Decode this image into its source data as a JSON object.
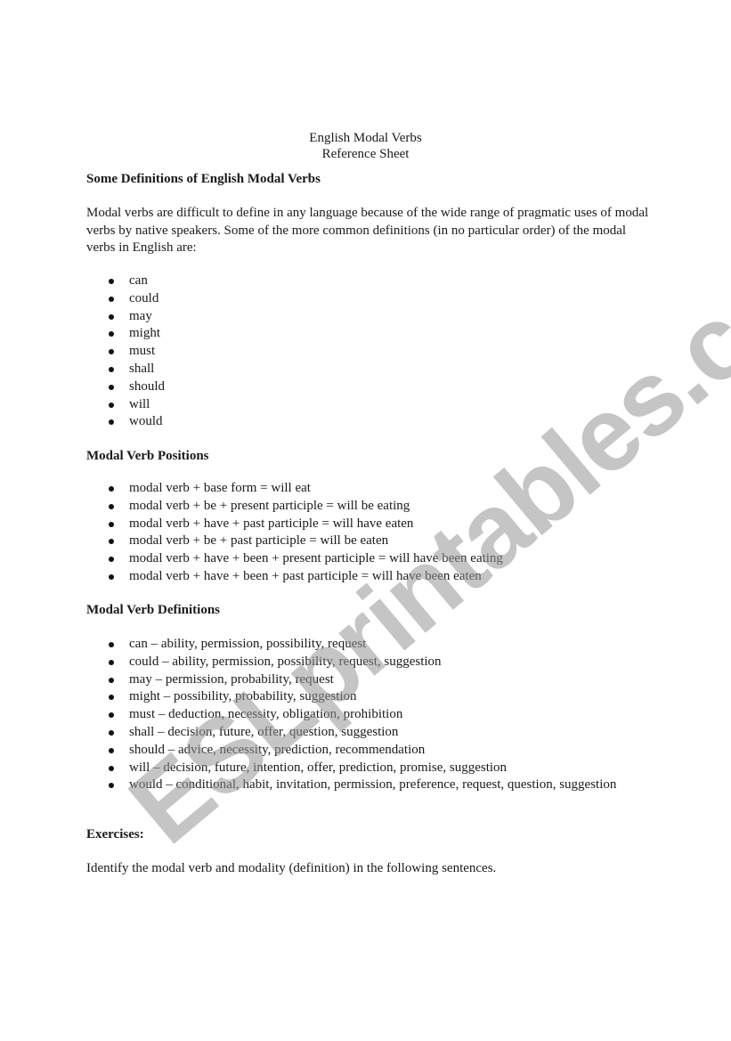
{
  "document": {
    "title_line1": "English Modal Verbs",
    "title_line2": "Reference Sheet",
    "section1": {
      "heading": "Some Definitions of English Modal Verbs",
      "paragraph": "Modal verbs are difficult to define in any language because of the wide range of pragmatic uses of modal verbs by native speakers. Some of the more common definitions (in no particular order) of the modal verbs in English are:",
      "items": [
        "can",
        "could",
        "may",
        "might",
        "must",
        "shall",
        "should",
        "will",
        "would"
      ]
    },
    "section2": {
      "heading": "Modal Verb Positions",
      "items": [
        "modal verb + base form = will eat",
        "modal verb + be + present participle = will be eating",
        "modal verb + have + past participle = will have eaten",
        "modal verb + be + past participle = will be eaten",
        "modal verb + have + been + present participle = will have been eating",
        "modal verb + have + been + past participle = will have been eaten"
      ]
    },
    "section3": {
      "heading": "Modal Verb Definitions",
      "items": [
        "can – ability, permission, possibility, request",
        "could – ability, permission, possibility, request, suggestion",
        "may – permission, probability, request",
        "might – possibility, probability, suggestion",
        "must – deduction, necessity, obligation, prohibition",
        "shall – decision, future, offer, question, suggestion",
        "should – advice, necessity, prediction, recommendation",
        "will – decision, future, intention, offer, prediction, promise, suggestion",
        "would – conditional, habit, invitation, permission, preference, request, question, suggestion"
      ]
    },
    "section4": {
      "heading": "Exercises:",
      "paragraph": "Identify the modal verb and modality (definition) in the following sentences."
    }
  },
  "watermark": "ESLprintables.com"
}
